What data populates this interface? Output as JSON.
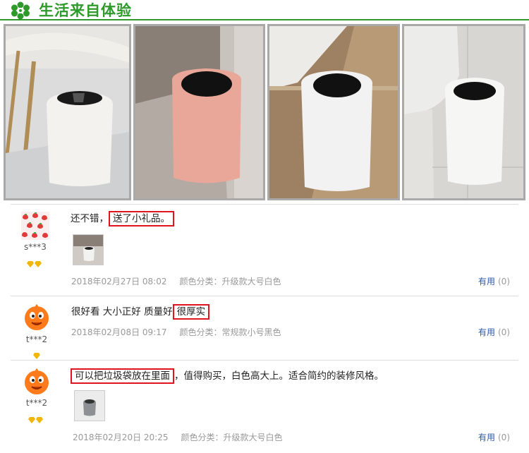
{
  "header": {
    "title": "生活来自体验",
    "icon": "flower-icon",
    "accent": "#2f9a2c"
  },
  "photos": [
    {
      "alt_icon": "white-trash-bin-photo"
    },
    {
      "alt_icon": "pink-trash-bin-photo"
    },
    {
      "alt_icon": "white-trash-bin-photo"
    },
    {
      "alt_icon": "white-trash-bin-photo"
    }
  ],
  "reviews": [
    {
      "user": "s***3",
      "diamonds": 2,
      "text_plain": "还不错，",
      "text_highlight": "送了小礼品。",
      "text_after": "",
      "date": "2018年02月27日 08:02",
      "category": "颜色分类：升级款大号白色",
      "useful_label": "有用",
      "useful_count": "(0)",
      "has_thumb": true
    },
    {
      "user": "t***2",
      "diamonds": 1,
      "text_plain": "很好看 大小正好 质量好",
      "text_highlight": "很厚实",
      "text_after": "",
      "date": "2018年02月08日 09:17",
      "category": "颜色分类：常规款小号黑色",
      "useful_label": "有用",
      "useful_count": "(0)",
      "has_thumb": false
    },
    {
      "user": "t***2",
      "diamonds": 2,
      "text_plain": "",
      "text_highlight": "可以把垃圾袋放在里面",
      "text_after": "，值得购买，白色高大上。适合简约的装修风格。",
      "date": "2018年02月20日 20:25",
      "category": "颜色分类：升级款大号白色",
      "useful_label": "有用",
      "useful_count": "(0)",
      "has_thumb": true
    }
  ],
  "colors": {
    "highlight_border": "#e0141e",
    "link": "#2a5aa8",
    "meta": "#999999"
  }
}
